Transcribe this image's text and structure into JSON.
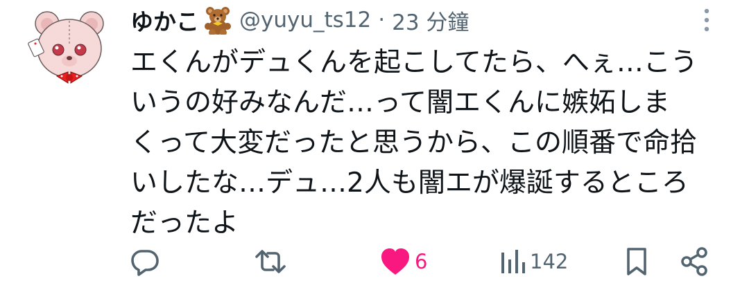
{
  "tweet": {
    "display_name": "ゆかこ",
    "name_emoji_icon": "teddy-bear-icon",
    "handle": "@yuyu_ts12",
    "separator": "·",
    "time": "23 分鐘",
    "text_lines": [
      "エくんがデュくんを起こしてたら、へぇ…こう",
      "いうの好みなんだ…って闇エくんに嫉妬しま",
      "くって大変だったと思うから、この順番で命拾",
      "いしたな…デュ…2人も闇エが爆誕するところ",
      "だったよ"
    ]
  },
  "actions": {
    "reply": {
      "icon": "reply-icon",
      "count": ""
    },
    "retweet": {
      "icon": "retweet-icon",
      "count": ""
    },
    "like": {
      "icon": "heart-icon",
      "count": "6",
      "active": true
    },
    "views": {
      "icon": "views-icon",
      "count": "142"
    },
    "bookmark": {
      "icon": "bookmark-icon",
      "count": ""
    },
    "share": {
      "icon": "share-icon",
      "count": ""
    }
  },
  "colors": {
    "text": "#0f1419",
    "secondary": "#536471",
    "like": "#f91880",
    "avatar_bear": "#f4d3d3",
    "avatar_bow": "#e8201f"
  }
}
